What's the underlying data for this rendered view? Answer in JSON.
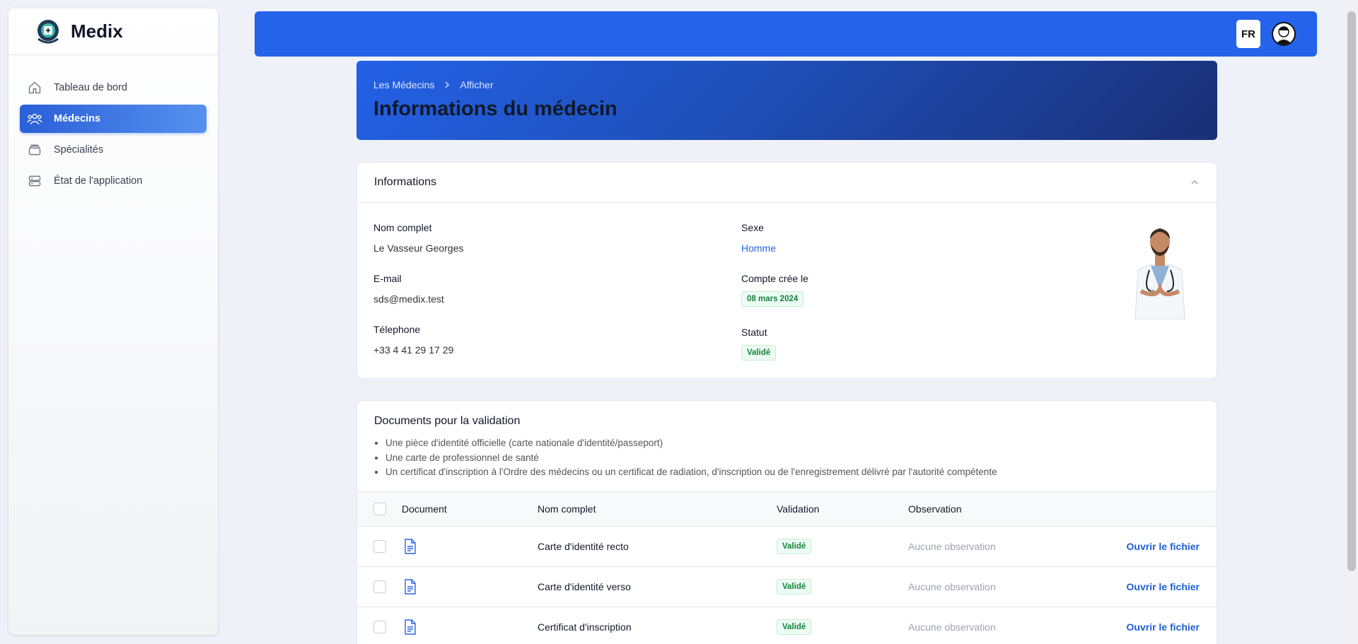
{
  "brand": {
    "name": "Medix"
  },
  "sidebar": {
    "items": [
      {
        "label": "Tableau de bord",
        "icon": "home-icon",
        "active": false
      },
      {
        "label": "Médecins",
        "icon": "users-icon",
        "active": true
      },
      {
        "label": "Spécialités",
        "icon": "layers-icon",
        "active": false
      },
      {
        "label": "État de l'application",
        "icon": "server-icon",
        "active": false
      }
    ]
  },
  "topbar": {
    "lang": "FR"
  },
  "header": {
    "breadcrumb": [
      "Les Médecins",
      "Afficher"
    ],
    "title": "Informations du médecin"
  },
  "info": {
    "section_title": "Informations",
    "full_name_label": "Nom complet",
    "full_name": "Le Vasseur Georges",
    "email_label": "E-mail",
    "email": "sds@medix.test",
    "phone_label": "Télephone",
    "phone": "+33 4 41 29 17 29",
    "sex_label": "Sexe",
    "sex": "Homme",
    "created_label": "Compte crée le",
    "created": "08 mars 2024",
    "status_label": "Statut",
    "status": "Validé"
  },
  "documents": {
    "title": "Documents pour la validation",
    "requirements": [
      "Une pièce d'identité officielle (carte nationale d'identité/passeport)",
      "Une carte de professionnel de santé",
      "Un certificat d'inscription à l'Ordre des médecins ou un certificat de radiation, d'inscription ou de l'enregistrement délivré par l'autorité compétente"
    ],
    "columns": {
      "document": "Document",
      "name": "Nom complet",
      "validation": "Validation",
      "observation": "Observation"
    },
    "rows": [
      {
        "name": "Carte d'identité recto",
        "validation": "Validé",
        "observation": "Aucune observation",
        "action": "Ouvrir le fichier"
      },
      {
        "name": "Carte d'identité verso",
        "validation": "Validé",
        "observation": "Aucune observation",
        "action": "Ouvrir le fichier"
      },
      {
        "name": "Certificat d'inscription",
        "validation": "Validé",
        "observation": "Aucune observation",
        "action": "Ouvrir le fichier"
      }
    ]
  },
  "colors": {
    "primary": "#2563eb",
    "success": "#15803d"
  }
}
